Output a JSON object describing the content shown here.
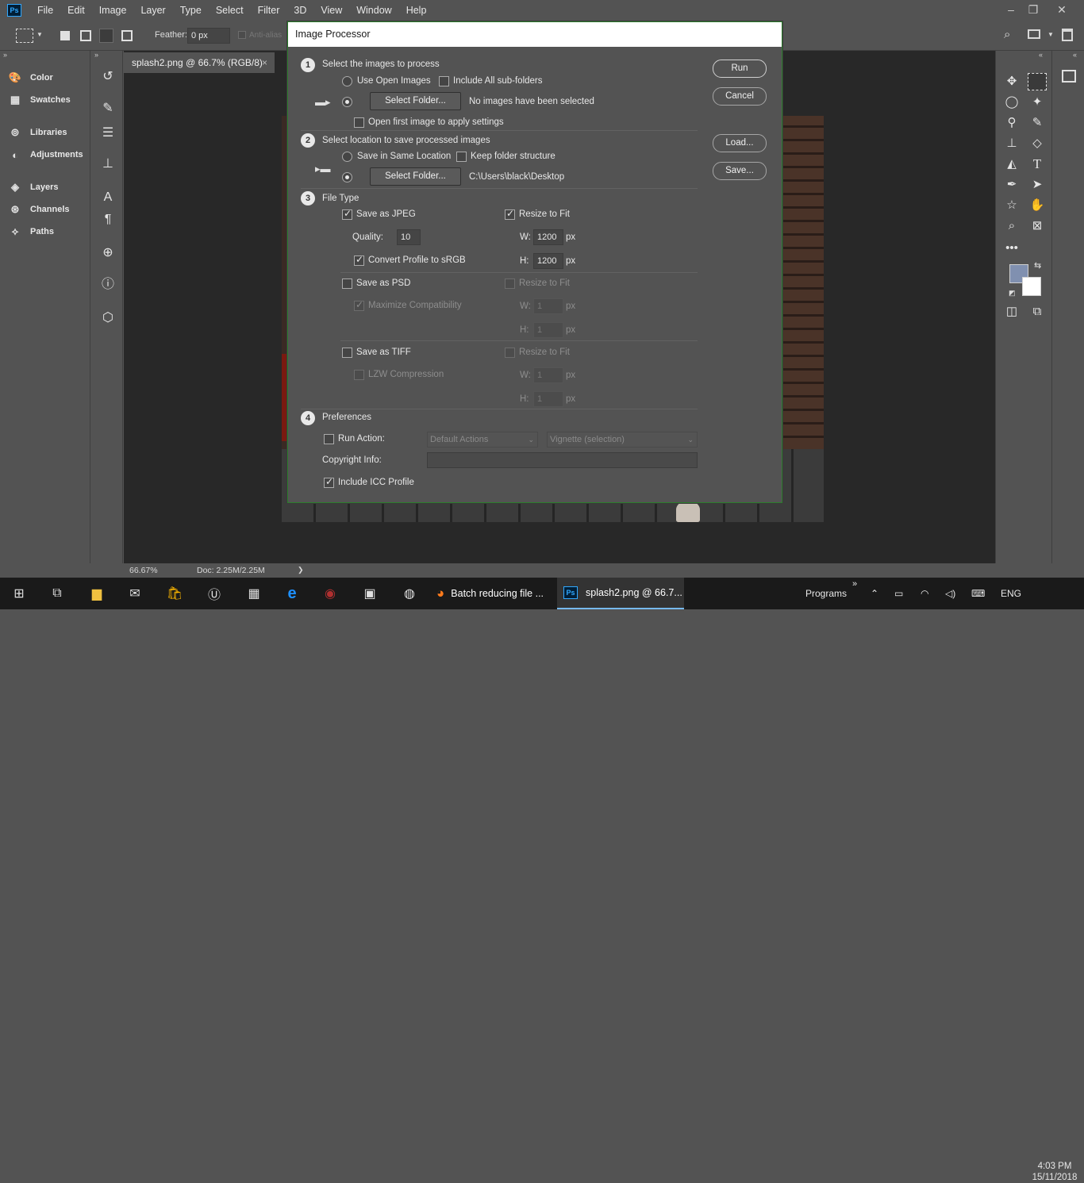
{
  "menubar": {
    "logo": "Ps",
    "items": [
      "File",
      "Edit",
      "Image",
      "Layer",
      "Type",
      "Select",
      "Filter",
      "3D",
      "View",
      "Window",
      "Help"
    ],
    "window_controls": [
      "–",
      "❐",
      "✕"
    ]
  },
  "options": {
    "feather_label": "Feather:",
    "feather_value": "0 px",
    "antialias_label": "Anti-alias"
  },
  "left_panels": {
    "items": [
      "Color",
      "Swatches",
      "Libraries",
      "Adjustments",
      "Layers",
      "Channels",
      "Paths"
    ]
  },
  "document": {
    "tab_title": "splash2.png @ 66.7% (RGB/8)",
    "tab_close": "×",
    "zoom": "66.67%",
    "doc_info": "Doc: 2.25M/2.25M",
    "status_arrow": "❯"
  },
  "dialog": {
    "title": "Image Processor",
    "step1": {
      "num": "1",
      "heading": "Select the images to process",
      "use_open_images": "Use Open Images",
      "include_subfolders": "Include All sub-folders",
      "select_folder": "Select Folder...",
      "status": "No images have been selected",
      "open_first": "Open first image to apply settings"
    },
    "step2": {
      "num": "2",
      "heading": "Select location to save processed images",
      "same_location": "Save in Same Location",
      "keep_structure": "Keep folder structure",
      "select_folder": "Select Folder...",
      "path": "C:\\Users\\black\\Desktop"
    },
    "step3": {
      "num": "3",
      "heading": "File Type",
      "save_jpeg": "Save as JPEG",
      "resize_fit": "Resize to Fit",
      "quality_label": "Quality:",
      "quality_value": "10",
      "w_label": "W:",
      "h_label": "H:",
      "jpeg_w": "1200",
      "jpeg_h": "1200",
      "px": "px",
      "convert_profile": "Convert Profile to sRGB",
      "save_psd": "Save as PSD",
      "maximize": "Maximize Compatibility",
      "psd_w": "1",
      "psd_h": "1",
      "save_tiff": "Save as TIFF",
      "lzw": "LZW Compression",
      "tiff_w": "1",
      "tiff_h": "1"
    },
    "step4": {
      "num": "4",
      "heading": "Preferences",
      "run_action": "Run Action:",
      "action_set": "Default Actions",
      "action": "Vignette (selection)",
      "copyright_label": "Copyright Info:",
      "copyright_value": "",
      "include_icc": "Include ICC Profile"
    },
    "buttons": {
      "run": "Run",
      "cancel": "Cancel",
      "load": "Load...",
      "save": "Save..."
    }
  },
  "taskbar": {
    "apps": [
      {
        "label": "Batch reducing file ..."
      },
      {
        "label": "splash2.png @ 66.7..."
      }
    ],
    "programs": "Programs",
    "programs_arrow": "»",
    "language": "ENG",
    "time": "4:03 PM",
    "date": "15/11/2018"
  },
  "colors": {
    "accent": "#31a8ff",
    "dialog_border": "#2c7d2c",
    "foreground_swatch": "#8090b0",
    "background_swatch": "#ffffff"
  }
}
